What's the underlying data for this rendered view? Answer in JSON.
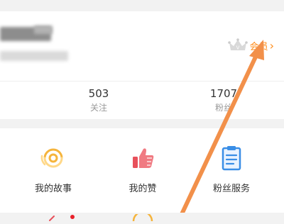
{
  "profile": {
    "username_redacted": "",
    "member": {
      "label": "会员",
      "chevron": "›"
    },
    "stats": [
      {
        "value": "503",
        "label": "关注"
      },
      {
        "value": "1707",
        "label": "粉丝"
      }
    ]
  },
  "menu": {
    "items": [
      {
        "label": "我的故事",
        "icon": "story-icon"
      },
      {
        "label": "我的赞",
        "icon": "thumbs-up-icon"
      },
      {
        "label": "粉丝服务",
        "icon": "clipboard-icon"
      }
    ]
  },
  "colors": {
    "accent": "#ff8c1a",
    "arrow": "#f2904a",
    "like": "#e8505b",
    "service": "#3a8ee6",
    "story": "#f5b43c"
  }
}
